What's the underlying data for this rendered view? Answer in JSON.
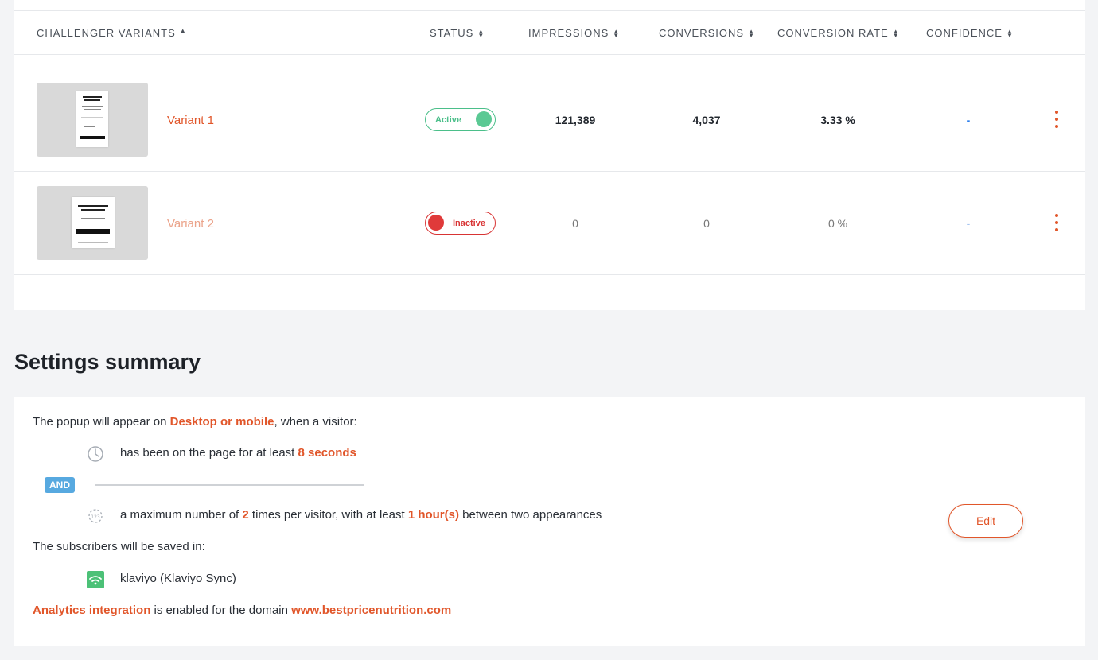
{
  "table": {
    "columns": [
      {
        "label": "CHALLENGER VARIANTS",
        "sort": "asc"
      },
      {
        "label": "STATUS",
        "sort": "both"
      },
      {
        "label": "IMPRESSIONS",
        "sort": "both"
      },
      {
        "label": "CONVERSIONS",
        "sort": "both"
      },
      {
        "label": "CONVERSION RATE",
        "sort": "both"
      },
      {
        "label": "CONFIDENCE",
        "sort": "both"
      }
    ],
    "rows": [
      {
        "name": "Variant 1",
        "status": "Active",
        "impressions": "121,389",
        "conversions": "4,037",
        "conversion_rate": "3.33 %",
        "confidence": "-"
      },
      {
        "name": "Variant 2",
        "status": "Inactive",
        "impressions": "0",
        "conversions": "0",
        "conversion_rate": "0 %",
        "confidence": "-"
      }
    ]
  },
  "settings": {
    "title": "Settings summary",
    "appear_prefix": "The popup will appear on ",
    "appear_device": "Desktop or mobile",
    "appear_suffix": ", when a visitor:",
    "time_prefix": "has been on the page for at least ",
    "time_value": "8 seconds",
    "and_label": "AND",
    "freq_prefix": "a maximum number of ",
    "freq_count": "2",
    "freq_mid": " times per visitor, with at least ",
    "freq_interval": "1 hour(s)",
    "freq_suffix": " between two appearances",
    "subscribers_text": "The subscribers will be saved in:",
    "integration_name": "klaviyo (Klaviyo Sync)",
    "analytics_label": "Analytics integration",
    "analytics_mid": " is enabled for the domain ",
    "analytics_domain": "www.bestpricenutrition.com",
    "edit_label": "Edit"
  },
  "colors": {
    "accent": "#e1562a",
    "active": "#4bbf8a",
    "inactive": "#d83434",
    "and_badge": "#57a9e0",
    "klaviyo": "#4cc177"
  },
  "icons": [
    "sort-asc-icon",
    "sort-both-icon",
    "kebab-menu-icon",
    "clock-icon",
    "frequency-counter-icon",
    "klaviyo-icon"
  ]
}
